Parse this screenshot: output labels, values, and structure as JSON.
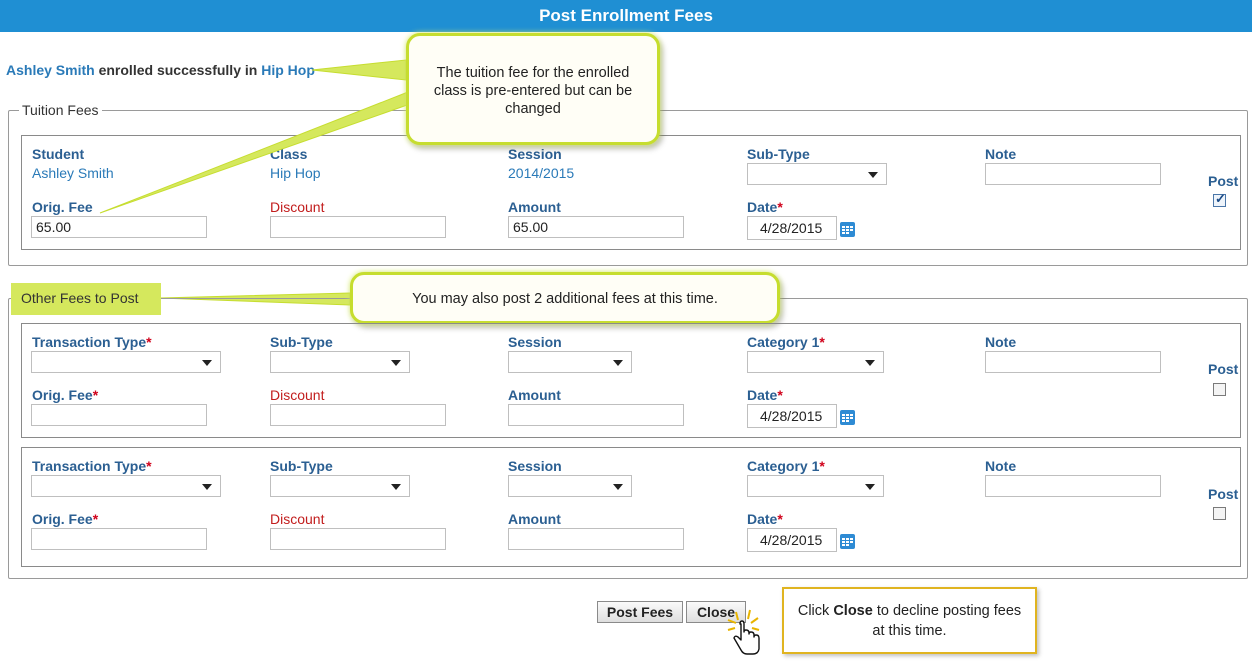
{
  "title": "Post Enrollment Fees",
  "success": {
    "student": "Ashley Smith",
    "middle": "enrolled successfully in",
    "class": "Hip Hop"
  },
  "tuition": {
    "legend": "Tuition Fees",
    "labels": {
      "student": "Student",
      "class": "Class",
      "session": "Session",
      "subtype": "Sub-Type",
      "note": "Note",
      "post": "Post",
      "orig_fee": "Orig. Fee",
      "discount": "Discount",
      "amount": "Amount",
      "date": "Date"
    },
    "values": {
      "student": "Ashley Smith",
      "class": "Hip Hop",
      "session": "2014/2015",
      "orig_fee": "65.00",
      "amount": "65.00",
      "date": "4/28/2015",
      "post_checked": true
    }
  },
  "other": {
    "legend": "Other Fees to Post",
    "labels": {
      "transaction_type": "Transaction Type",
      "subtype": "Sub-Type",
      "session": "Session",
      "category": "Category 1",
      "note": "Note",
      "post": "Post",
      "orig_fee": "Orig. Fee",
      "discount": "Discount",
      "amount": "Amount",
      "date": "Date"
    },
    "rows": [
      {
        "date": "4/28/2015",
        "post_checked": false
      },
      {
        "date": "4/28/2015",
        "post_checked": false
      }
    ]
  },
  "required_mark": "*",
  "buttons": {
    "post_fees": "Post Fees",
    "close": "Close"
  },
  "callouts": {
    "tuition": "The tuition fee for the enrolled class is pre-entered but can be changed",
    "other": "You may also post 2 additional fees at this time.",
    "close_pre": "Click",
    "close_bold": "Close",
    "close_post": "to decline posting fees at this time."
  },
  "colors": {
    "titlebar": "#1f8fd3",
    "label": "#2b5f92",
    "link": "#2a7ab8",
    "discount": "#c21d1d",
    "callout_border": "#c6dd2f",
    "tip_border": "#e0b420"
  }
}
